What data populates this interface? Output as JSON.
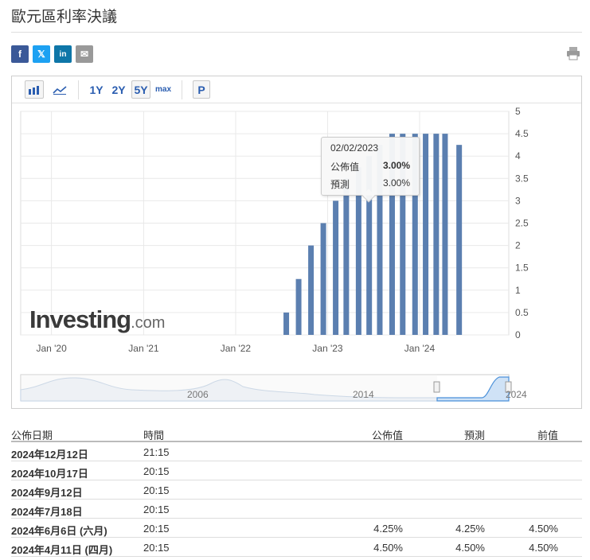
{
  "page": {
    "title": "歐元區利率決議"
  },
  "share": {
    "facebook": "f",
    "twitter": "𝕏",
    "linkedin": "in",
    "email": "✉"
  },
  "toolbar": {
    "range_1y": "1Y",
    "range_2y": "2Y",
    "range_5y": "5Y",
    "range_max": "max",
    "p": "P"
  },
  "tooltip": {
    "date": "02/02/2023",
    "actual_label": "公佈值",
    "actual_value": "3.00%",
    "forecast_label": "預測",
    "forecast_value": "3.00%"
  },
  "logo": {
    "text": "Investing",
    "suffix": ".com"
  },
  "chart_data": {
    "type": "bar",
    "color": "#5b7fb0",
    "x_ticks": [
      "Jan '20",
      "Jan '21",
      "Jan '22",
      "Jan '23",
      "Jan '24"
    ],
    "y_ticks": [
      "0",
      "0.5",
      "1",
      "1.5",
      "2",
      "2.5",
      "3",
      "3.5",
      "4",
      "4.5",
      "5"
    ],
    "ylim": [
      0,
      5
    ],
    "xlim": [
      "2019-09-01",
      "2024-12-20"
    ],
    "grid": true,
    "y_axis_side": "right",
    "series": [
      {
        "x": [
          "2022-07-21",
          "2022-09-08",
          "2022-10-27",
          "2022-12-15",
          "2023-02-02",
          "2023-03-16",
          "2023-05-04",
          "2023-06-15",
          "2023-07-27",
          "2023-09-14",
          "2023-10-26",
          "2023-12-14",
          "2024-01-25",
          "2024-03-07",
          "2024-04-11",
          "2024-06-06"
        ],
        "values": [
          0.5,
          1.25,
          2.0,
          2.5,
          3.0,
          3.5,
          3.75,
          4.0,
          4.25,
          4.5,
          4.5,
          4.5,
          4.5,
          4.5,
          4.5,
          4.25
        ]
      }
    ],
    "navigator": {
      "labels": [
        "2006",
        "2014",
        "2024"
      ]
    }
  },
  "table": {
    "headers": {
      "date": "公佈日期",
      "time": "時間",
      "actual": "公佈值",
      "forecast": "預測",
      "previous": "前值"
    },
    "rows": [
      {
        "date": "2024年12月12日",
        "time": "21:15",
        "actual": "",
        "forecast": "",
        "previous": ""
      },
      {
        "date": "2024年10月17日",
        "time": "20:15",
        "actual": "",
        "forecast": "",
        "previous": ""
      },
      {
        "date": "2024年9月12日",
        "time": "20:15",
        "actual": "",
        "forecast": "",
        "previous": ""
      },
      {
        "date": "2024年7月18日",
        "time": "20:15",
        "actual": "",
        "forecast": "",
        "previous": ""
      },
      {
        "date": "2024年6月6日 (六月)",
        "time": "20:15",
        "actual": "4.25%",
        "forecast": "4.25%",
        "previous": "4.50%"
      },
      {
        "date": "2024年4月11日 (四月)",
        "time": "20:15",
        "actual": "4.50%",
        "forecast": "4.50%",
        "previous": "4.50%"
      }
    ]
  }
}
